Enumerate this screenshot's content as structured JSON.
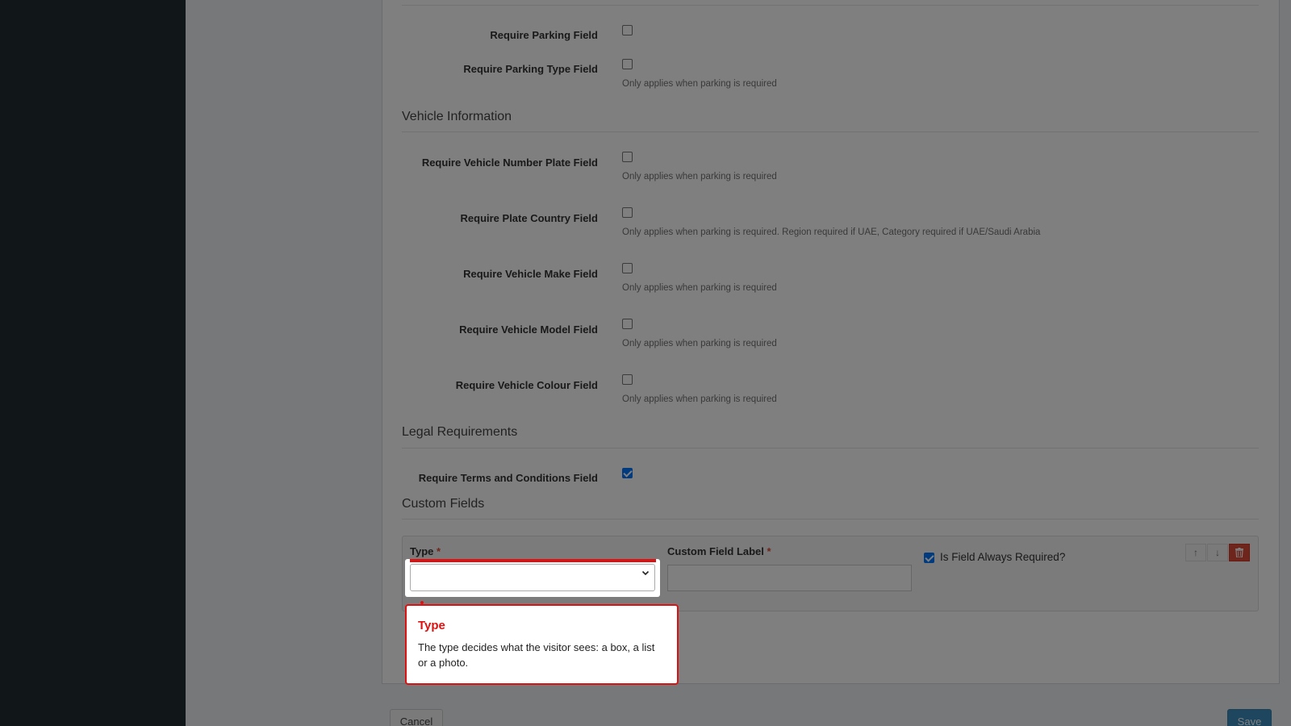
{
  "parking": {
    "require_parking_label": "Require Parking Field",
    "require_parking_type_label": "Require Parking Type Field",
    "parking_type_help": "Only applies when parking is required"
  },
  "vehicle": {
    "title": "Vehicle Information",
    "number_plate_label": "Require Vehicle Number Plate Field",
    "number_plate_help": "Only applies when parking is required",
    "plate_country_label": "Require Plate Country Field",
    "plate_country_help": "Only applies when parking is required. Region required if UAE, Category required if UAE/Saudi Arabia",
    "make_label": "Require Vehicle Make Field",
    "make_help": "Only applies when parking is required",
    "model_label": "Require Vehicle Model Field",
    "model_help": "Only applies when parking is required",
    "colour_label": "Require Vehicle Colour Field",
    "colour_help": "Only applies when parking is required"
  },
  "legal": {
    "title": "Legal Requirements",
    "terms_label": "Require Terms and Conditions Field",
    "terms_checked": true
  },
  "custom_fields": {
    "title": "Custom Fields",
    "type_label": "Type",
    "label_label": "Custom Field Label",
    "required_star": "*",
    "always_required_label": "Is Field Always Required?",
    "always_required_checked": true,
    "type_value": "",
    "label_value": ""
  },
  "tooltip": {
    "title": "Type",
    "body": "The type decides what the visitor sees: a box, a list or a photo."
  },
  "footer": {
    "cancel_label": "Cancel",
    "save_label": "Save"
  },
  "icons": {
    "up": "arrow-up-icon",
    "down": "arrow-down-icon",
    "delete": "trash-icon"
  },
  "colors": {
    "highlight": "#dd1111",
    "primary": "#3c8dbc",
    "danger": "#dd4b39",
    "sidebar": "#222d32"
  }
}
